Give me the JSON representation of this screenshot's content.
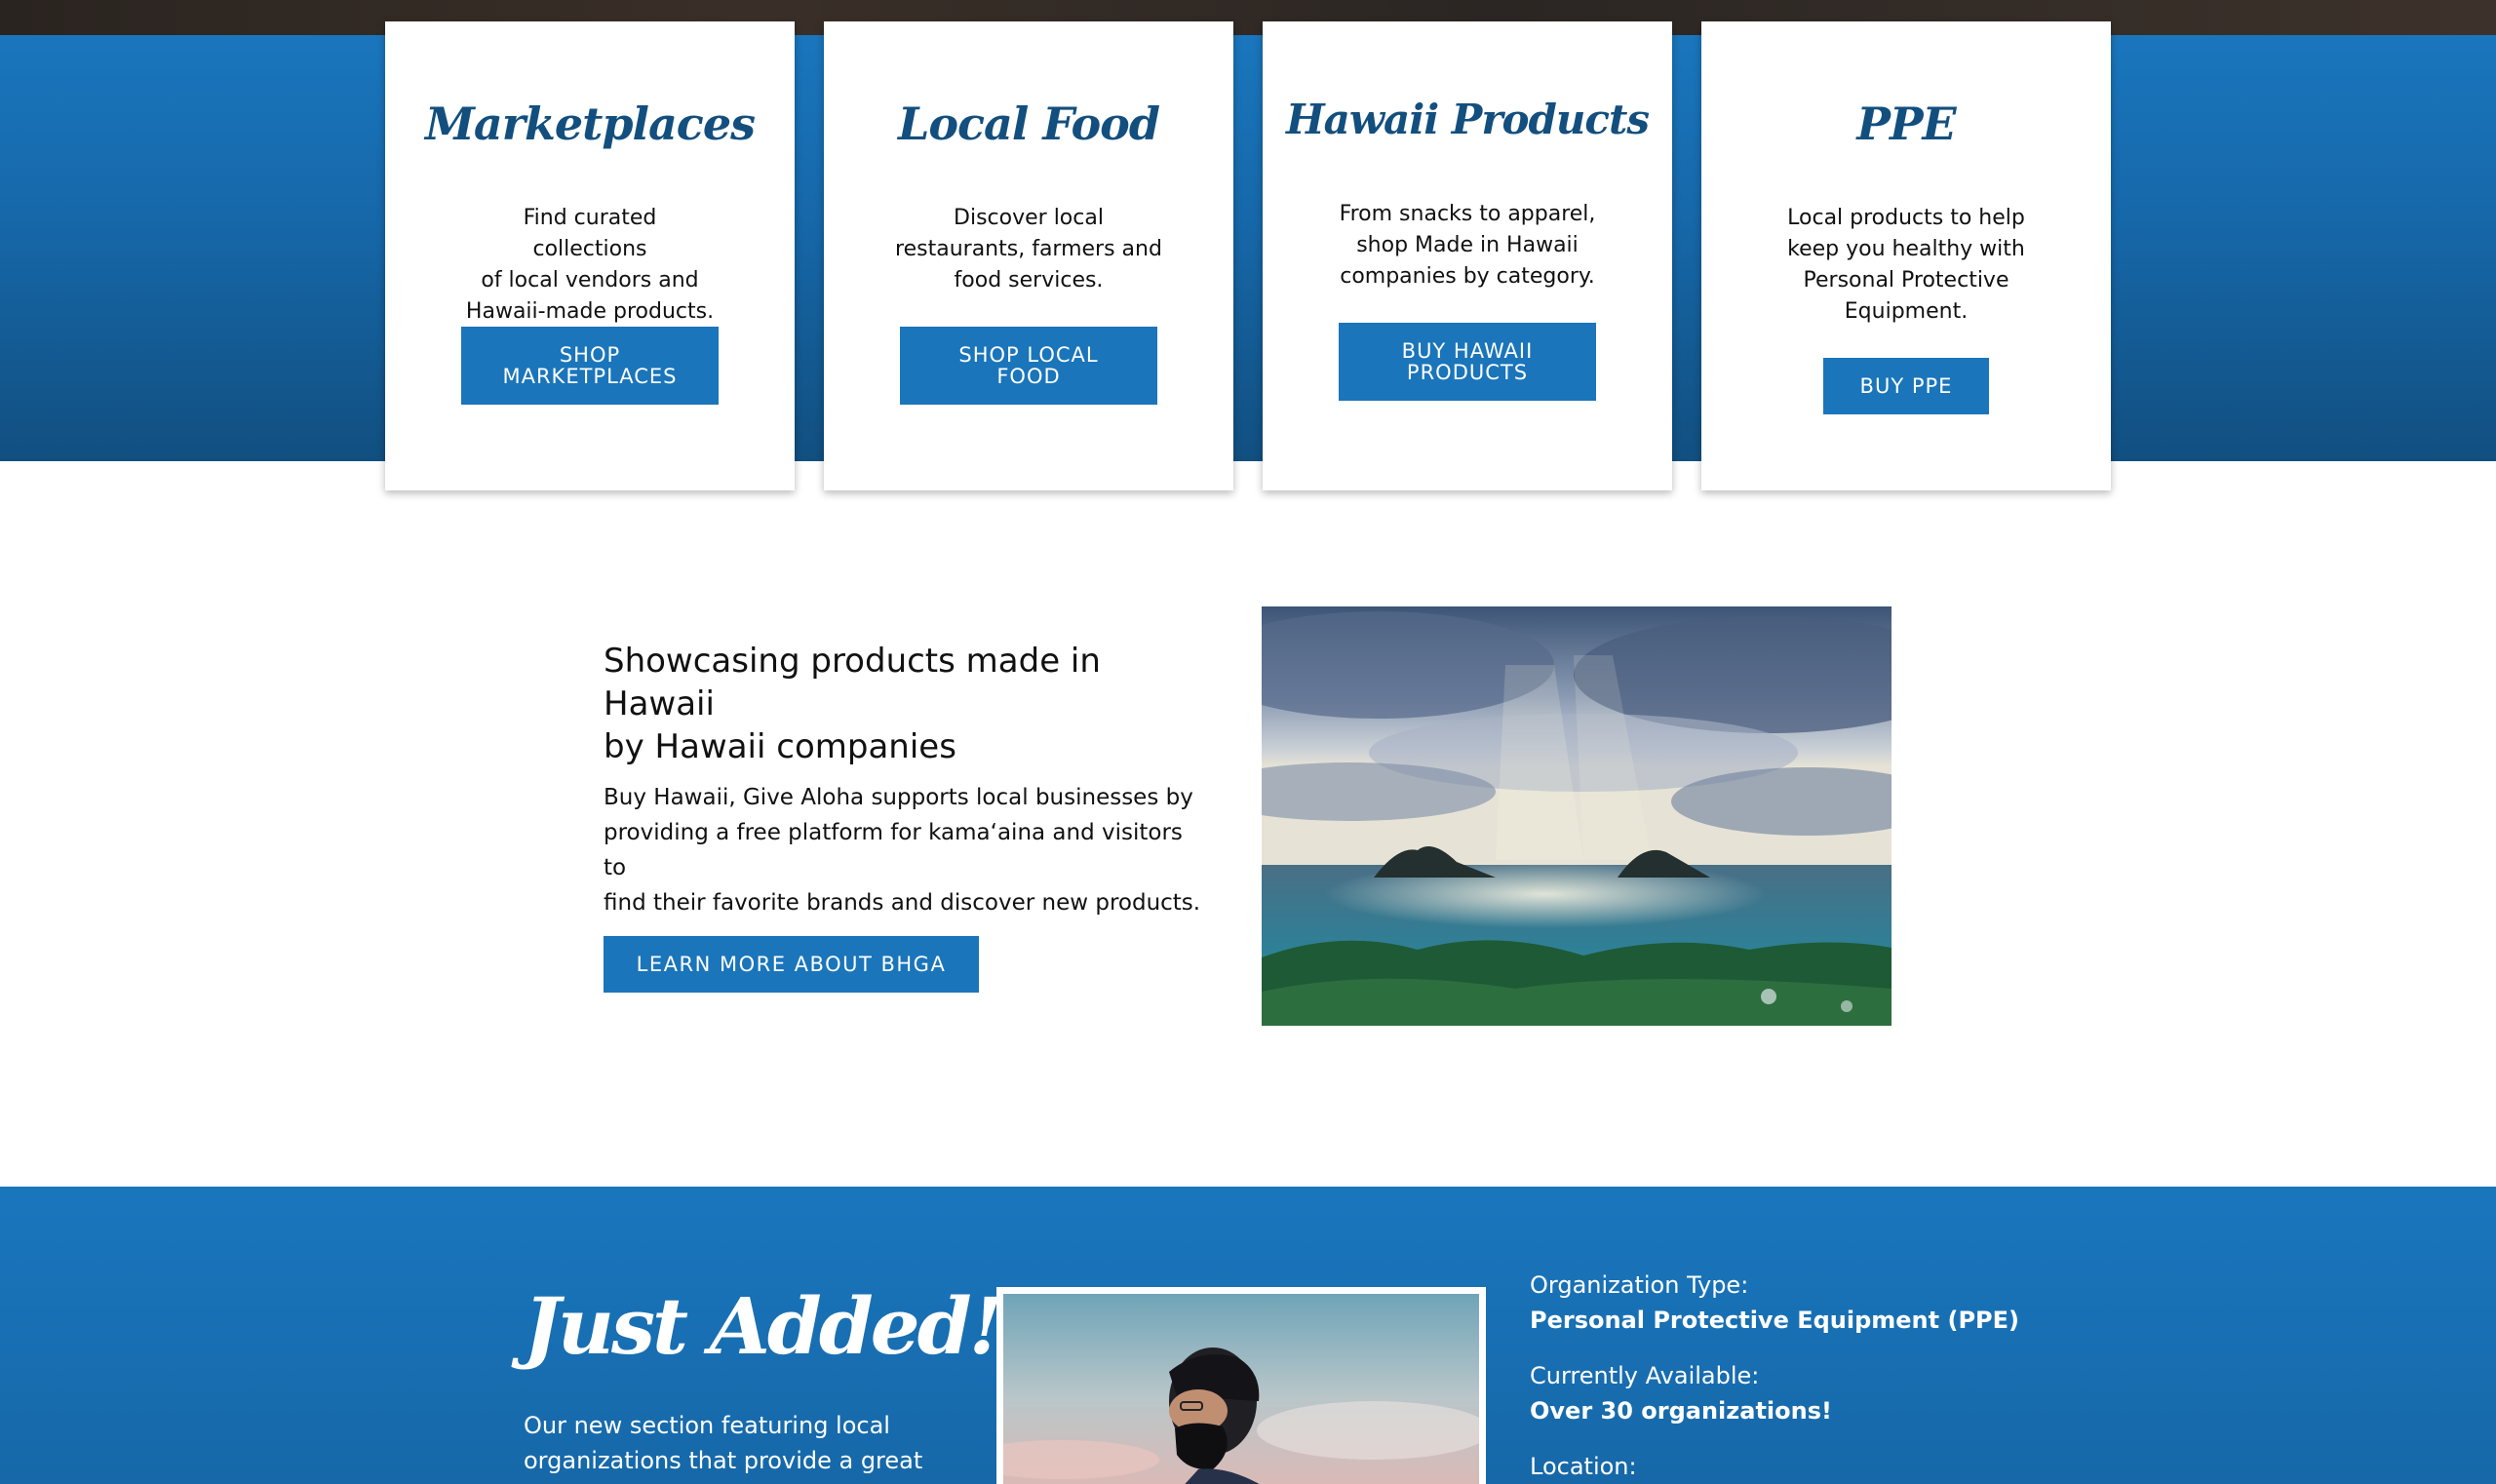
{
  "cards": [
    {
      "title": "Marketplaces",
      "desc_lines": [
        "Find curated collections",
        "of local vendors and",
        "Hawaii-made products."
      ],
      "button_lines": [
        "SHOP",
        "MARKETPLACES"
      ]
    },
    {
      "title": "Local Food",
      "desc_lines": [
        "Discover local",
        "restaurants, farmers and",
        "food services."
      ],
      "button_lines": [
        "SHOP LOCAL",
        "FOOD"
      ]
    },
    {
      "title": "Hawaii Products",
      "desc_lines": [
        "From snacks to apparel,",
        "shop Made in Hawaii",
        "companies by category."
      ],
      "button_lines": [
        "BUY HAWAII",
        "PRODUCTS"
      ]
    },
    {
      "title": "PPE",
      "desc_lines": [
        "Local products to help",
        "keep you healthy with",
        "Personal Protective",
        "Equipment."
      ],
      "button_lines": [
        "BUY PPE"
      ]
    }
  ],
  "about": {
    "heading_lines": [
      "Showcasing products made in Hawaii",
      "by Hawaii companies"
    ],
    "text_lines": [
      "Buy Hawaii, Give Aloha supports local businesses by",
      "providing a free platform for kama‘aina and visitors to",
      "find their favorite brands and discover new products."
    ],
    "button_label": "LEARN MORE ABOUT BHGA"
  },
  "just_added": {
    "title": "Just Added!",
    "text_lines": [
      "Our new section featuring local",
      "organizations that provide a great"
    ],
    "info": [
      {
        "label": "Organization Type:",
        "value": "Personal Protective Equipment (PPE)"
      },
      {
        "label": "Currently Available:",
        "value": "Over 30 organizations!"
      },
      {
        "label": "Location:",
        "value": ""
      }
    ]
  },
  "colors": {
    "brand_blue": "#1a75bb",
    "title_navy": "#134f7e"
  }
}
